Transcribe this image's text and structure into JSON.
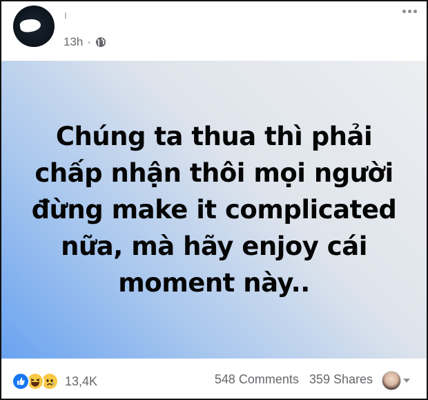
{
  "post": {
    "timestamp": "13h",
    "privacy_icon": "globe-icon",
    "text": "Chúng ta thua thì phải chấp nhận thôi mọi người đừng make it complicated nữa, mà hãy enjoy cái moment này..",
    "background_gradient": [
      "#6aa3f0",
      "#eceef1"
    ]
  },
  "footer": {
    "reaction_icons": [
      "like-icon",
      "haha-icon",
      "sad-icon"
    ],
    "reaction_count": "13,4K",
    "comments": "548 Comments",
    "shares": "359 Shares"
  },
  "colors": {
    "like": "#1877f2",
    "meta_text": "#65676b"
  }
}
